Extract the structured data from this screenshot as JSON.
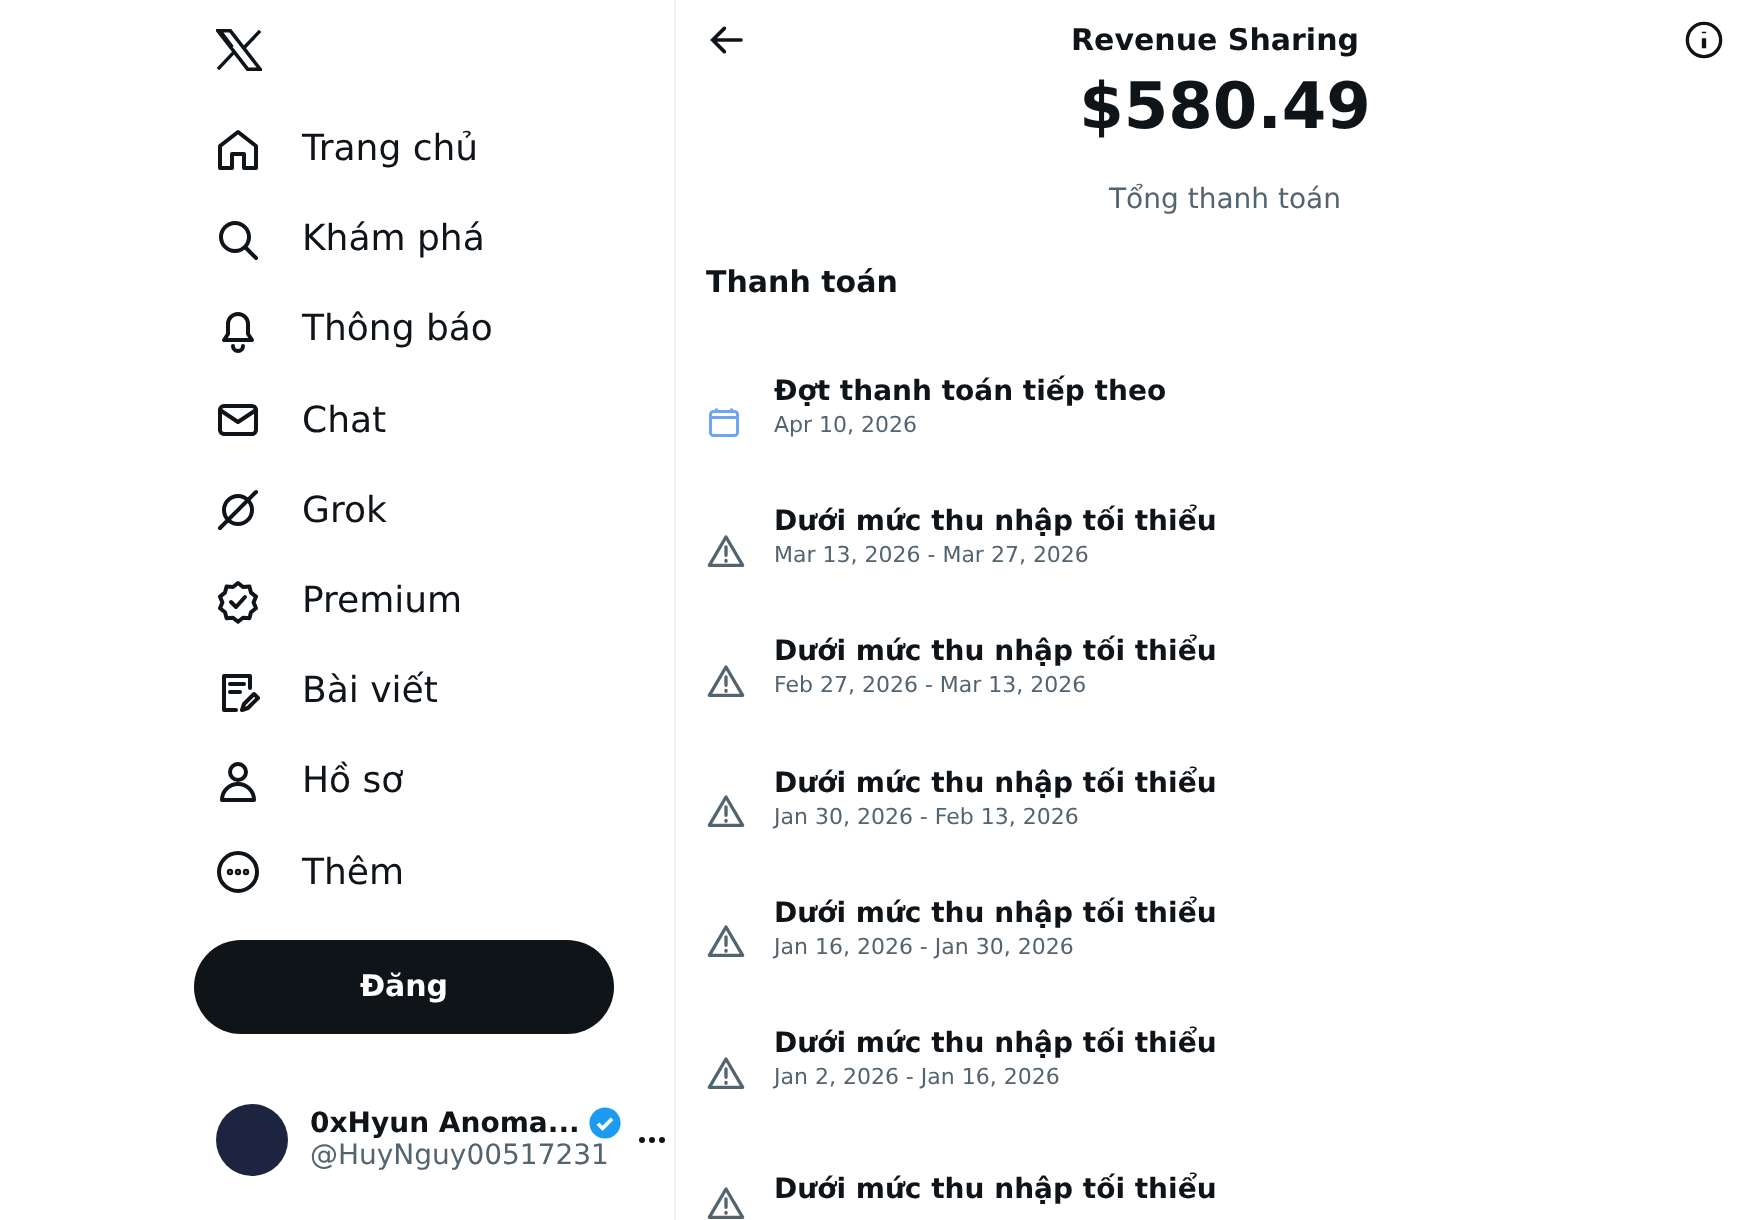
{
  "sidebar": {
    "nav": [
      {
        "kind": "home",
        "label": "Trang chủ"
      },
      {
        "kind": "search",
        "label": "Khám phá"
      },
      {
        "kind": "bell",
        "label": "Thông báo"
      },
      {
        "kind": "mail",
        "label": "Chat"
      },
      {
        "kind": "grok",
        "label": "Grok"
      },
      {
        "kind": "badge",
        "label": "Premium"
      },
      {
        "kind": "article",
        "label": "Bài viết"
      },
      {
        "kind": "person",
        "label": "Hồ sơ"
      },
      {
        "kind": "more",
        "label": "Thêm"
      }
    ],
    "post_button": "Đăng",
    "account": {
      "name": "0xHyun Anoma...",
      "handle": "@HuyNguy00517231",
      "verified": true
    }
  },
  "header": {
    "title": "Revenue Sharing"
  },
  "total": {
    "amount": "$580.49",
    "label": "Tổng thanh toán"
  },
  "payments": {
    "heading": "Thanh toán",
    "items": [
      {
        "kind": "calendar",
        "title": "Đợt thanh toán tiếp theo",
        "date": "Apr 10, 2026"
      },
      {
        "kind": "warning",
        "title": "Dưới mức thu nhập tối thiểu",
        "date": "Mar 13, 2026 - Mar 27, 2026"
      },
      {
        "kind": "warning",
        "title": "Dưới mức thu nhập tối thiểu",
        "date": "Feb 27, 2026 - Mar 13, 2026"
      },
      {
        "kind": "warning",
        "title": "Dưới mức thu nhập tối thiểu",
        "date": "Jan 30, 2026 - Feb 13, 2026"
      },
      {
        "kind": "warning",
        "title": "Dưới mức thu nhập tối thiểu",
        "date": "Jan 16, 2026 - Jan 30, 2026"
      },
      {
        "kind": "warning",
        "title": "Dưới mức thu nhập tối thiểu",
        "date": "Jan 2, 2026 - Jan 16, 2026"
      },
      {
        "kind": "warning",
        "title": "Dưới mức thu nhập tối thiểu"
      }
    ]
  }
}
